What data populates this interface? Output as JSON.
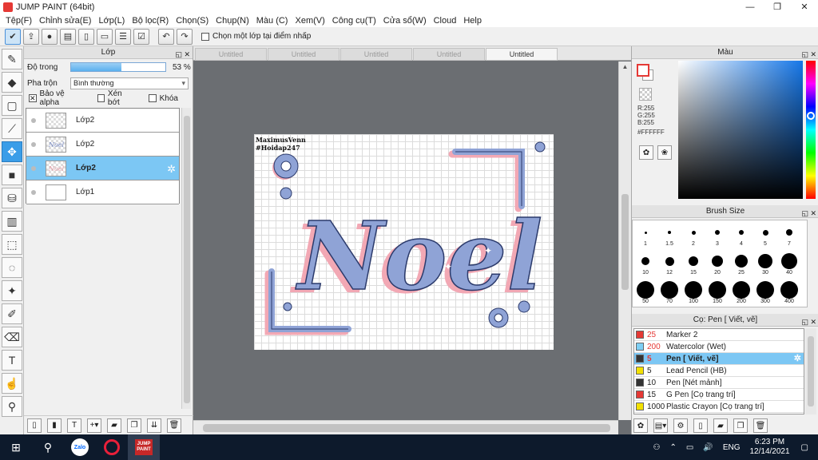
{
  "window": {
    "title": "JUMP PAINT (64bit)",
    "minimize": "—",
    "restore": "❐",
    "close": "✕"
  },
  "menu": [
    "Tệp(F)",
    "Chỉnh sửa(E)",
    "Lớp(L)",
    "Bộ lọc(R)",
    "Chọn(S)",
    "Chụp(N)",
    "Màu (C)",
    "Xem(V)",
    "Công cụ(T)",
    "Cửa sổ(W)",
    "Cloud",
    "Help"
  ],
  "toolbar": {
    "pick_layer_label": "Chọn một lớp tại điểm nhấp"
  },
  "layer_panel": {
    "title": "Lớp",
    "opacity_label": "Độ trong",
    "opacity_value": "53 %",
    "opacity_fraction": 0.53,
    "blend_label": "Pha trộn",
    "blend_value": "Bình thường",
    "protect_alpha": "Bảo vệ alpha",
    "clipping": "Xén bớt",
    "lock": "Khóa",
    "layers": [
      {
        "name": "Lớp2",
        "selected": false
      },
      {
        "name": "Lớp2",
        "selected": false
      },
      {
        "name": "Lớp2",
        "selected": true
      },
      {
        "name": "Lớp1",
        "selected": false
      }
    ]
  },
  "canvas": {
    "tabs": [
      "Untitled",
      "Untitled",
      "Untitled",
      "Untitled",
      "Untitled"
    ],
    "active_tab": 4,
    "watermark_line1": "MaximusVenn",
    "watermark_line2": "#Hoidap247",
    "art_text": "Noel"
  },
  "color_panel": {
    "title": "Màu",
    "r": "R:255",
    "g": "G:255",
    "b": "B:255",
    "hex": "#FFFFFF"
  },
  "brush_size_panel": {
    "title": "Brush Size",
    "sizes": [
      "1",
      "1.5",
      "2",
      "3",
      "4",
      "5",
      "7",
      "10",
      "12",
      "15",
      "20",
      "25",
      "30",
      "40",
      "50",
      "70",
      "100",
      "150",
      "200",
      "300",
      "400"
    ]
  },
  "brush_list_panel": {
    "title": "Cọ: Pen [ Viết, vẽ]",
    "brushes": [
      {
        "size": "25",
        "name": "Marker 2",
        "color": "#e53935",
        "red": true
      },
      {
        "size": "200",
        "name": "Watercolor (Wet)",
        "color": "#7ecff5",
        "red": true
      },
      {
        "size": "5",
        "name": "Pen [ Viết, vẽ]",
        "color": "#333333",
        "red": true,
        "selected": true
      },
      {
        "size": "5",
        "name": "Lead Pencil (HB)",
        "color": "#f2e000",
        "red": false
      },
      {
        "size": "10",
        "name": "Pen [Nét mảnh]",
        "color": "#333333",
        "red": false
      },
      {
        "size": "15",
        "name": "G Pen [Cọ trang trí]",
        "color": "#e53935",
        "red": false
      },
      {
        "size": "1000",
        "name": "Plastic Crayon [Cọ trang trí]",
        "color": "#f2e000",
        "red": false
      }
    ]
  },
  "taskbar": {
    "zalo_label": "Zalo",
    "jp_label": "JUMP PAINT",
    "lang": "ENG",
    "time": "6:23 PM",
    "date": "12/14/2021"
  },
  "colors": {
    "accent": "#3a9de8",
    "selection": "#7cc7f4",
    "art_fill": "#8fa3d6",
    "art_shadow": "#f2a8b4",
    "art_outline": "#2b3a6b"
  }
}
